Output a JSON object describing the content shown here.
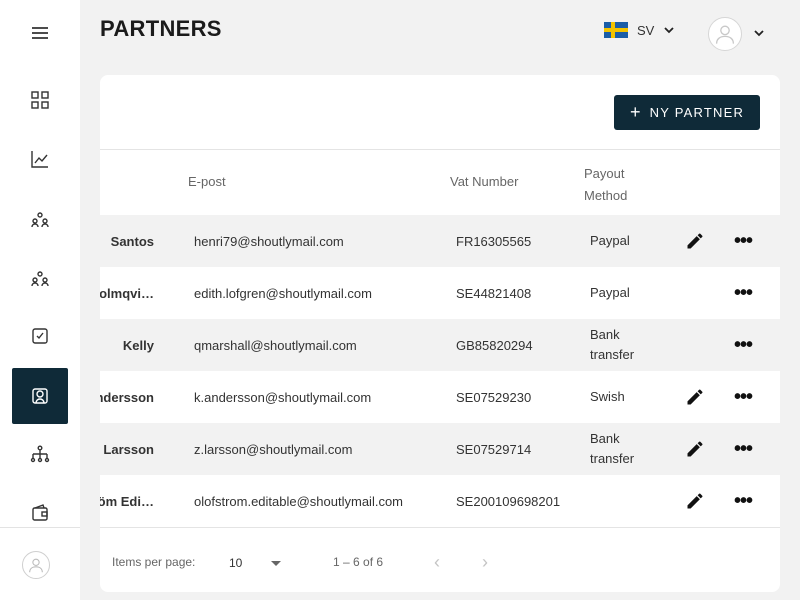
{
  "header": {
    "title": "PARTNERS",
    "language": "SV"
  },
  "toolbar": {
    "new_partner_label": "NY PARTNER"
  },
  "table": {
    "columns": {
      "email": "E-post",
      "vat": "Vat Number",
      "payout": "Payout Method"
    },
    "rows": [
      {
        "name": "Santos",
        "email": "henri79@shoutlymail.com",
        "vat": "FR16305565",
        "payout": "Paypal",
        "editable": true
      },
      {
        "name": "Holmqvi…",
        "email": "edith.lofgren@shoutlymail.com",
        "vat": "SE44821408",
        "payout": "Paypal",
        "editable": false
      },
      {
        "name": "Kelly",
        "email": "qmarshall@shoutlymail.com",
        "vat": "GB85820294",
        "payout": "Bank transfer",
        "editable": false
      },
      {
        "name": "Andersson",
        "email": "k.andersson@shoutlymail.com",
        "vat": "SE07529230",
        "payout": "Swish",
        "editable": true
      },
      {
        "name": "Larsson",
        "email": "z.larsson@shoutlymail.com",
        "vat": "SE07529714",
        "payout": "Bank transfer",
        "editable": true
      },
      {
        "name": "Ström Edi…",
        "email": "olofstrom.editable@shoutlymail.com",
        "vat": "SE200109698201",
        "payout": "",
        "editable": true
      }
    ]
  },
  "pagination": {
    "items_per_page_label": "Items per page:",
    "page_size": "10",
    "range": "1 – 6 of 6"
  },
  "icons": {
    "menu": "hamburger-icon",
    "dashboard": "grid-icon",
    "stats": "line-chart-icon",
    "partners": "users-icon",
    "tasks": "checkbox-icon",
    "wallet": "wallet-icon"
  },
  "colors": {
    "accent": "#0f2a38",
    "flag_blue": "#1b5ea8",
    "flag_yellow": "#f3c400"
  }
}
